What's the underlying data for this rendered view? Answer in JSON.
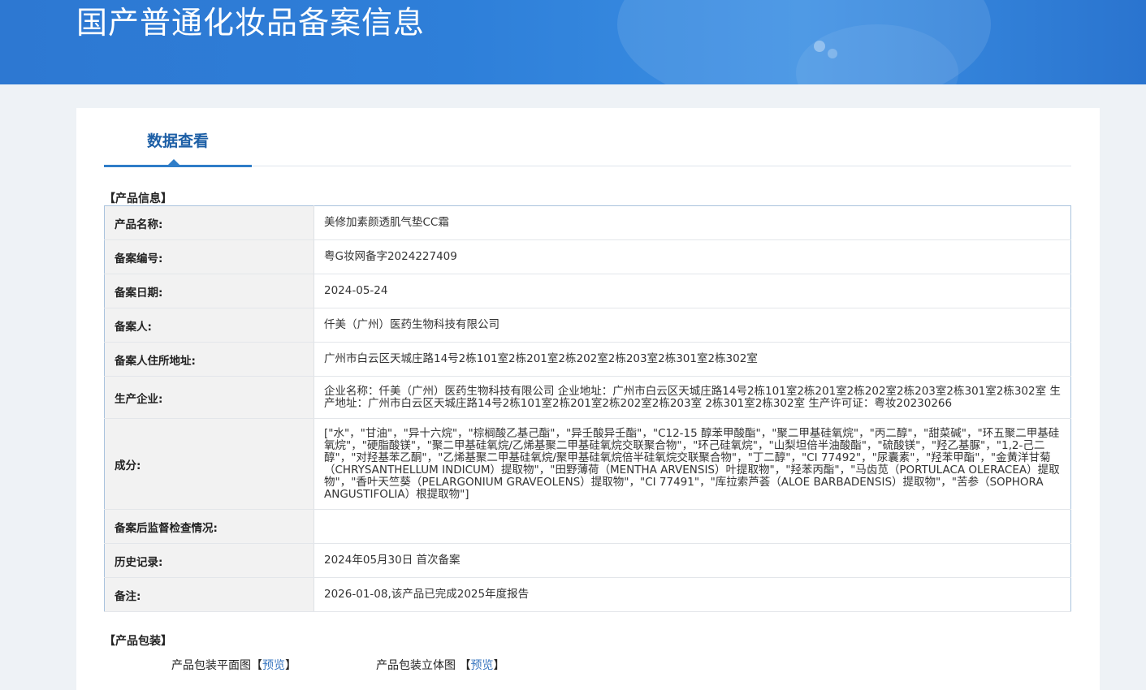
{
  "header": {
    "title": "国产普通化妆品备案信息"
  },
  "tab": {
    "label": "数据查看"
  },
  "sections": {
    "product_info": "【产品信息】",
    "packaging": "【产品包装】"
  },
  "rows": [
    {
      "label": "产品名称:",
      "value": "美修加素颜透肌气垫CC霜"
    },
    {
      "label": "备案编号:",
      "value": "粤G妆网备字2024227409"
    },
    {
      "label": "备案日期:",
      "value": "2024-05-24"
    },
    {
      "label": "备案人:",
      "value": "仟美（广州）医药生物科技有限公司"
    },
    {
      "label": "备案人住所地址:",
      "value": "广州市白云区天城庄路14号2栋101室2栋201室2栋202室2栋203室2栋301室2栋302室"
    },
    {
      "label": "生产企业:",
      "value": "企业名称：仟美（广州）医药生物科技有限公司 企业地址：广州市白云区天城庄路14号2栋101室2栋201室2栋202室2栋203室2栋301室2栋302室 生产地址：广州市白云区天城庄路14号2栋101室2栋201室2栋202室2栋203室 2栋301室2栋302室 生产许可证：粤妆20230266"
    },
    {
      "label": "成分:",
      "value": "[\"水\"，\"甘油\"，\"异十六烷\"，\"棕榈酸乙基己酯\"，\"异壬酸异壬酯\"，\"C12-15 醇苯甲酸酯\"，\"聚二甲基硅氧烷\"，\"丙二醇\"，\"甜菜碱\"，\"环五聚二甲基硅氧烷\"，\"硬脂酸镁\"，\"聚二甲基硅氧烷/乙烯基聚二甲基硅氧烷交联聚合物\"，\"环己硅氧烷\"，\"山梨坦倍半油酸酯\"，\"硫酸镁\"，\"羟乙基脲\"，\"1,2-己二醇\"，\"对羟基苯乙酮\"，\"乙烯基聚二甲基硅氧烷/聚甲基硅氧烷倍半硅氧烷交联聚合物\"，\"丁二醇\"，\"CI 77492\"，\"尿囊素\"，\"羟苯甲酯\"，\"金黄洋甘菊（CHRYSANTHELLUM INDICUM）提取物\"，\"田野薄荷（MENTHA ARVENSIS）叶提取物\"，\"羟苯丙酯\"，\"马齿苋（PORTULACA OLERACEA）提取物\"，\"香叶天竺葵（PELARGONIUM GRAVEOLENS）提取物\"，\"CI 77491\"，\"库拉索芦荟（ALOE BARBADENSIS）提取物\"，\"苦参（SOPHORA ANGUSTIFOLIA）根提取物\"]"
    },
    {
      "label": "备案后监督检查情况:",
      "value": ""
    },
    {
      "label": "历史记录:",
      "value": "2024年05月30日 首次备案"
    },
    {
      "label": "备注:",
      "value": "2026-01-08,该产品已完成2025年度报告"
    }
  ],
  "packaging": {
    "flat_label": "产品包装平面图",
    "solid_label": "产品包装立体图",
    "bracket_open": "【",
    "bracket_close": "】",
    "preview_link": "预览"
  },
  "colors": {
    "banner": "#2d78d2",
    "tab_active": "#1d5fa6",
    "link": "#3a77c0",
    "label_bg": "#f2f2f2"
  }
}
